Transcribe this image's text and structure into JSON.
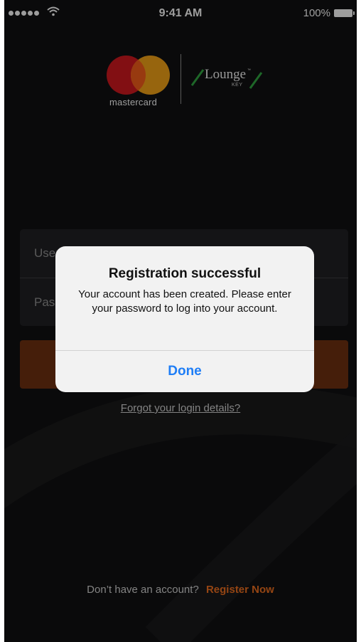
{
  "status_bar": {
    "time": "9:41 AM",
    "battery_percent": "100%"
  },
  "branding": {
    "mastercard_wordmark": "mastercard",
    "lounge_wordmark": "Lounge",
    "lounge_tm": "™",
    "lounge_key": "KEY",
    "colors": {
      "mc_red": "#c8181e",
      "mc_yellow": "#e99b16",
      "lounge_slash": "#2e9e3e"
    }
  },
  "form": {
    "username_placeholder": "Username",
    "password_placeholder": "Password",
    "login_button_color": "#6b2f10"
  },
  "links": {
    "forgot": "Forgot your login details?",
    "register_question": "Don’t have an account?",
    "register_link": "Register Now",
    "accent": "#e56a1e"
  },
  "alert": {
    "title": "Registration successful",
    "message": "Your account has been created. Please enter your password to log into your account.",
    "button": "Done",
    "button_color": "#1f7ef6"
  }
}
